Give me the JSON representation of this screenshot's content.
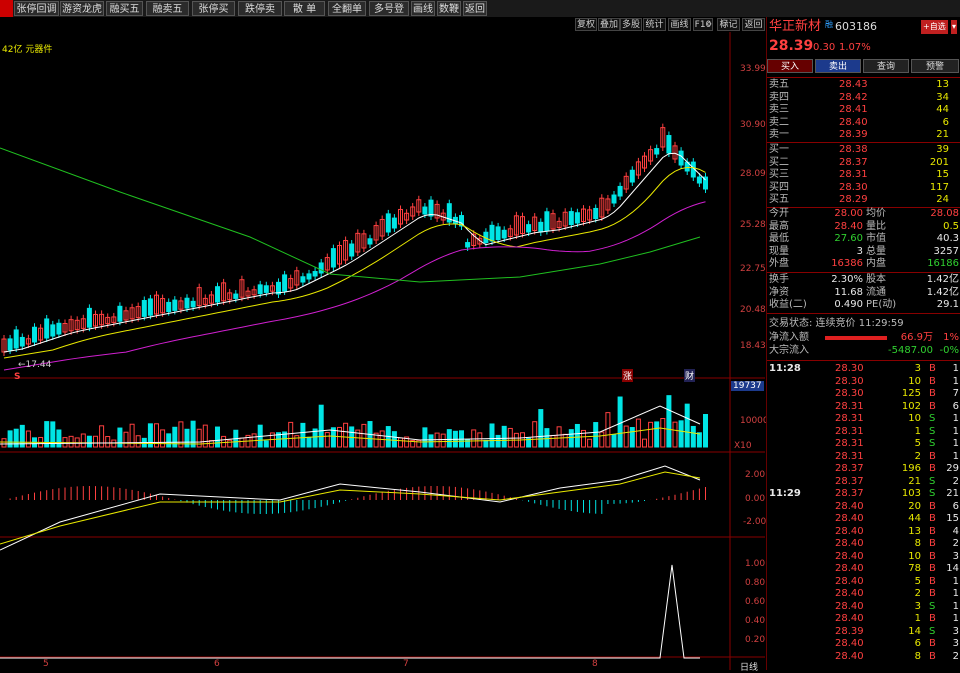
{
  "toolbar": {
    "buttons": [
      "张停回调",
      "游资龙虎",
      "融买五",
      "融卖五",
      "张停买",
      "跌停卖",
      "散 单",
      "全翻单",
      "多号登录",
      "画线",
      "数鞭",
      "返回"
    ]
  },
  "subtoolbar": {
    "buttons": [
      "复权",
      "叠加",
      "多股",
      "统计",
      "画线",
      "F10",
      "标记",
      "返回"
    ]
  },
  "main_chart": {
    "info": "42亿 元器件",
    "price_ticks": [
      "33.99",
      "30.90",
      "28.09",
      "25.28",
      "22.75",
      "20.48",
      "18.43"
    ],
    "low_label": "17.44",
    "bottom_markers": [
      "S",
      "涨",
      "财"
    ],
    "vol_ticks": [
      "19737",
      "10000",
      "X10"
    ],
    "macd_ticks": [
      "2.00",
      "0.00",
      "-2.00"
    ],
    "ind_ticks": [
      "1.00",
      "0.80",
      "0.60",
      "0.40",
      "0.20"
    ],
    "date_ticks": [
      "5",
      "6",
      "7",
      "8"
    ],
    "period": "日线"
  },
  "quote": {
    "name": "华正新材",
    "code": "603186",
    "tag": "融",
    "watch_btn": "+自选",
    "price": "28.39",
    "change": "0.30",
    "change_pct": "1.07%",
    "actions": [
      "买入",
      "卖出",
      "查询",
      "预警"
    ],
    "asks": [
      {
        "label": "卖五",
        "price": "28.43",
        "vol": "13"
      },
      {
        "label": "卖四",
        "price": "28.42",
        "vol": "34"
      },
      {
        "label": "卖三",
        "price": "28.41",
        "vol": "44"
      },
      {
        "label": "卖二",
        "price": "28.40",
        "vol": "6"
      },
      {
        "label": "卖一",
        "price": "28.39",
        "vol": "21"
      }
    ],
    "bids": [
      {
        "label": "买一",
        "price": "28.38",
        "vol": "39"
      },
      {
        "label": "买二",
        "price": "28.37",
        "vol": "201"
      },
      {
        "label": "买三",
        "price": "28.31",
        "vol": "15"
      },
      {
        "label": "买四",
        "price": "28.30",
        "vol": "117"
      },
      {
        "label": "买五",
        "price": "28.29",
        "vol": "24"
      }
    ],
    "stats": [
      {
        "k1": "今开",
        "v1": "28.00",
        "k2": "均价",
        "v2": "28.08"
      },
      {
        "k1": "最高",
        "v1": "28.40",
        "k2": "量比",
        "v2": "0.5"
      },
      {
        "k1": "最低",
        "v1": "27.60",
        "k2": "市值",
        "v2": "40.3"
      },
      {
        "k1": "现量",
        "v1": "3",
        "k2": "总量",
        "v2": "3257"
      },
      {
        "k1": "外盘",
        "v1": "16386",
        "k2": "内盘",
        "v2": "16186"
      }
    ],
    "stats2": [
      {
        "k1": "换手",
        "v1": "2.30%",
        "k2": "股本",
        "v2": "1.42亿"
      },
      {
        "k1": "净资",
        "v1": "11.68",
        "k2": "流通",
        "v2": "1.42亿"
      },
      {
        "k1": "收益(二)",
        "v1": "0.490",
        "k2": "PE(动)",
        "v2": "29.1"
      }
    ],
    "trade_status": "交易状态: 连续竞价 11:29:59",
    "net_inflow_label": "净流入额",
    "net_inflow_val": "66.9万",
    "net_inflow_pct": "1%",
    "big_inflow_label": "大宗流入",
    "big_inflow_val": "-5487.00",
    "big_inflow_pct": "-0%",
    "ticks": [
      {
        "t": "11:28",
        "p": "28.30",
        "v": "3",
        "d": "B",
        "n": "1"
      },
      {
        "t": "",
        "p": "28.30",
        "v": "10",
        "d": "B",
        "n": "1"
      },
      {
        "t": "",
        "p": "28.30",
        "v": "125",
        "d": "B",
        "n": "7"
      },
      {
        "t": "",
        "p": "28.31",
        "v": "102",
        "d": "B",
        "n": "6"
      },
      {
        "t": "",
        "p": "28.31",
        "v": "10",
        "d": "S",
        "n": "1"
      },
      {
        "t": "",
        "p": "28.31",
        "v": "1",
        "d": "S",
        "n": "1"
      },
      {
        "t": "",
        "p": "28.31",
        "v": "5",
        "d": "S",
        "n": "1"
      },
      {
        "t": "",
        "p": "28.31",
        "v": "2",
        "d": "B",
        "n": "1"
      },
      {
        "t": "",
        "p": "28.37",
        "v": "196",
        "d": "B",
        "n": "29"
      },
      {
        "t": "",
        "p": "28.37",
        "v": "21",
        "d": "S",
        "n": "2"
      },
      {
        "t": "11:29",
        "p": "28.37",
        "v": "103",
        "d": "S",
        "n": "21"
      },
      {
        "t": "",
        "p": "28.40",
        "v": "20",
        "d": "B",
        "n": "6"
      },
      {
        "t": "",
        "p": "28.40",
        "v": "44",
        "d": "B",
        "n": "15"
      },
      {
        "t": "",
        "p": "28.40",
        "v": "13",
        "d": "B",
        "n": "4"
      },
      {
        "t": "",
        "p": "28.40",
        "v": "8",
        "d": "B",
        "n": "2"
      },
      {
        "t": "",
        "p": "28.40",
        "v": "10",
        "d": "B",
        "n": "3"
      },
      {
        "t": "",
        "p": "28.40",
        "v": "78",
        "d": "B",
        "n": "14"
      },
      {
        "t": "",
        "p": "28.40",
        "v": "5",
        "d": "B",
        "n": "1"
      },
      {
        "t": "",
        "p": "28.40",
        "v": "2",
        "d": "B",
        "n": "1"
      },
      {
        "t": "",
        "p": "28.40",
        "v": "3",
        "d": "S",
        "n": "1"
      },
      {
        "t": "",
        "p": "28.40",
        "v": "1",
        "d": "B",
        "n": "1"
      },
      {
        "t": "",
        "p": "28.39",
        "v": "14",
        "d": "S",
        "n": "3"
      },
      {
        "t": "",
        "p": "28.40",
        "v": "6",
        "d": "B",
        "n": "3"
      },
      {
        "t": "",
        "p": "28.40",
        "v": "8",
        "d": "B",
        "n": "2"
      }
    ]
  }
}
